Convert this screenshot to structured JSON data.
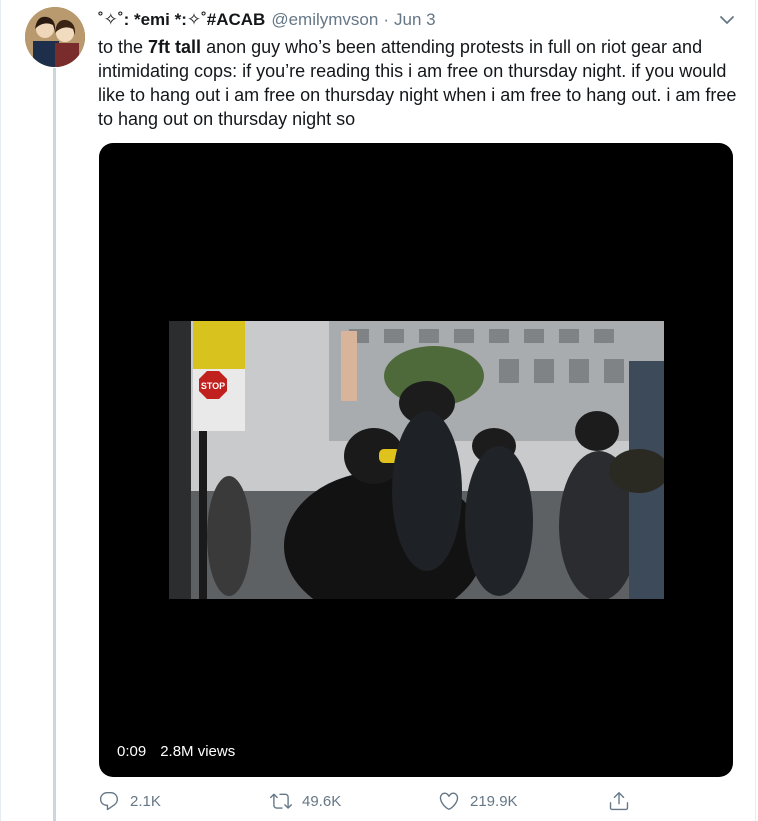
{
  "tweet": {
    "display_name": "˚✧˚: *emi *:✧˚#ACAB",
    "handle": "@emilymvson",
    "separator": "·",
    "date": "Jun 3",
    "text_before": "to the ",
    "text_bold": "7ft tall",
    "text_after": " anon guy who’s been attending protests in full on riot gear and intimidating cops: if you’re reading this i am free on thursday night. if you would like to hang out i am free on thursday night when i am free to hang out. i am free to hang out on thursday night so"
  },
  "media": {
    "duration": "0:09",
    "views": "2.8M views",
    "sign_text": "STOP"
  },
  "actions": {
    "reply_count": "2.1K",
    "retweet_count": "49.6K",
    "like_count": "219.9K"
  },
  "icons": {
    "caret": "chevron-down-icon",
    "reply": "reply-icon",
    "retweet": "retweet-icon",
    "like": "heart-icon",
    "share": "share-icon"
  },
  "colors": {
    "text_primary": "#14171a",
    "text_secondary": "#657786",
    "thread_line": "#ccd6dd"
  }
}
